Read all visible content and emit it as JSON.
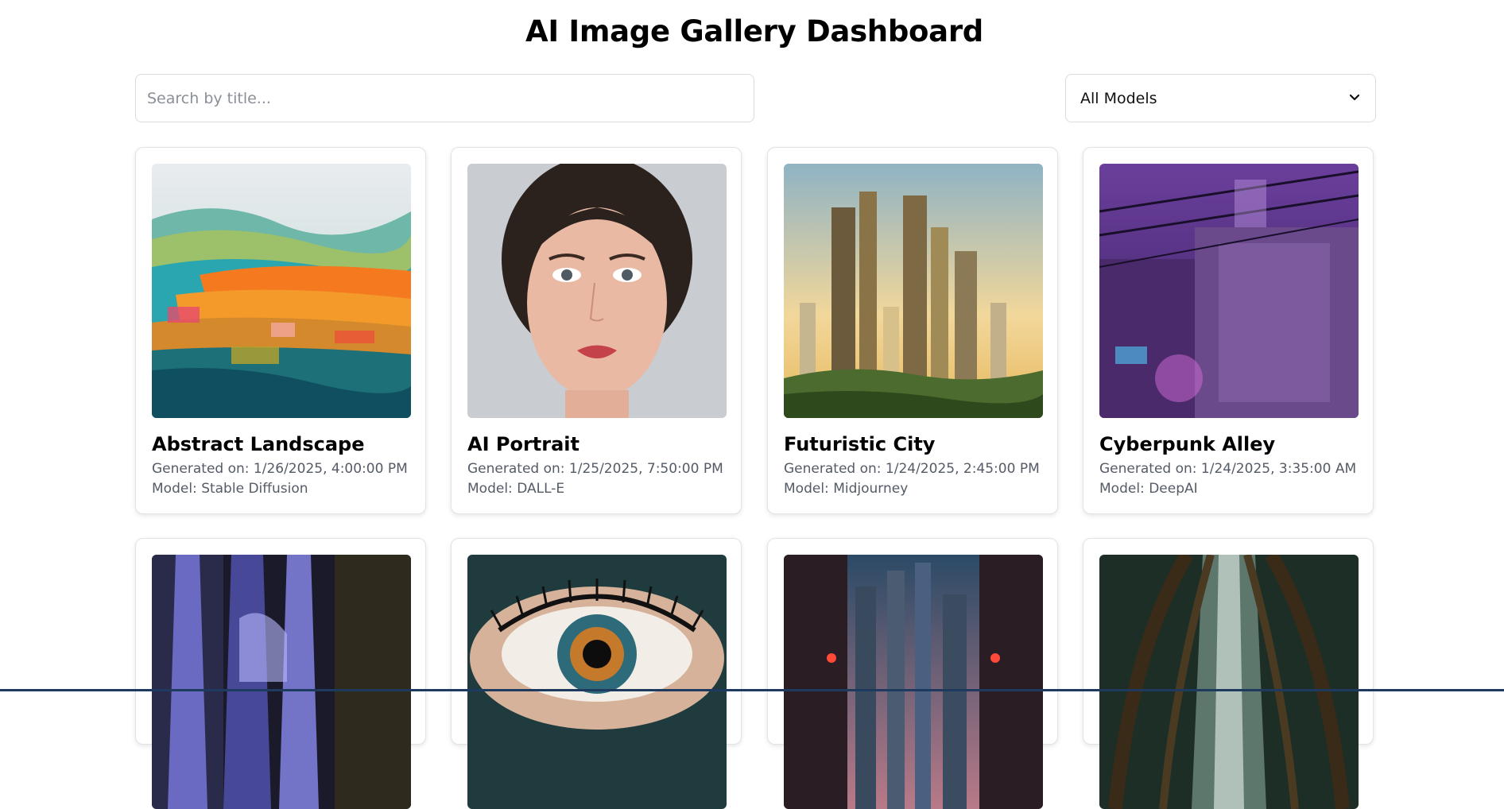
{
  "header": {
    "title": "AI Image Gallery Dashboard"
  },
  "search": {
    "placeholder": "Search by title..."
  },
  "filter": {
    "selected": "All Models",
    "icon": "chevron-down-icon"
  },
  "cards": [
    {
      "title": "Abstract Landscape",
      "date_label": "Generated on:",
      "date": "1/26/2025, 4:00:00 PM",
      "model_label": "Model:",
      "model": "Stable Diffusion",
      "image": "abstract-landscape-image"
    },
    {
      "title": "AI Portrait",
      "date_label": "Generated on:",
      "date": "1/25/2025, 7:50:00 PM",
      "model_label": "Model:",
      "model": "DALL-E",
      "image": "portrait-image"
    },
    {
      "title": "Futuristic City",
      "date_label": "Generated on:",
      "date": "1/24/2025, 2:45:00 PM",
      "model_label": "Model:",
      "model": "Midjourney",
      "image": "futuristic-city-image"
    },
    {
      "title": "Cyberpunk Alley",
      "date_label": "Generated on:",
      "date": "1/24/2025, 3:35:00 AM",
      "model_label": "Model:",
      "model": "DeepAI",
      "image": "cyberpunk-alley-image"
    },
    {
      "image": "waterfall-image"
    },
    {
      "image": "eye-image"
    },
    {
      "image": "city-street-image"
    },
    {
      "image": "forest-path-image"
    }
  ],
  "colors": {
    "accent_bar": "#1f3a5f",
    "meta_text": "#555b66",
    "border": "#e3e3e3"
  }
}
